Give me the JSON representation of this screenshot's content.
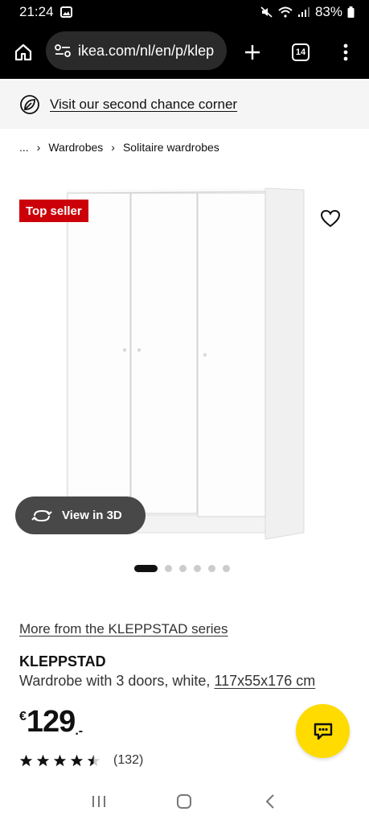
{
  "status_bar": {
    "time": "21:24",
    "battery": "83%"
  },
  "browser": {
    "url": "ikea.com/nl/en/p/klep",
    "tab_count": "14"
  },
  "banner": {
    "text": "Visit our second chance corner"
  },
  "breadcrumb": {
    "ellipsis": "...",
    "items": [
      "Wardrobes",
      "Solitaire wardrobes"
    ]
  },
  "product": {
    "badge": "Top seller",
    "view3d_label": "View in 3D",
    "series_link": "More from the KLEPPSTAD series",
    "name": "KLEPPSTAD",
    "description": "Wardrobe with 3 doors, white,",
    "dimensions": "117x55x176 cm",
    "price_currency": "€",
    "price_amount": "129",
    "price_decimal": ".-",
    "rating_stars": 4.5,
    "rating_count": "(132)"
  },
  "carousel": {
    "total": 6,
    "active_index": 0
  },
  "colors": {
    "badge_red": "#cc0008",
    "chat_yellow": "#ffdb00",
    "view3d_bg": "#484848"
  }
}
